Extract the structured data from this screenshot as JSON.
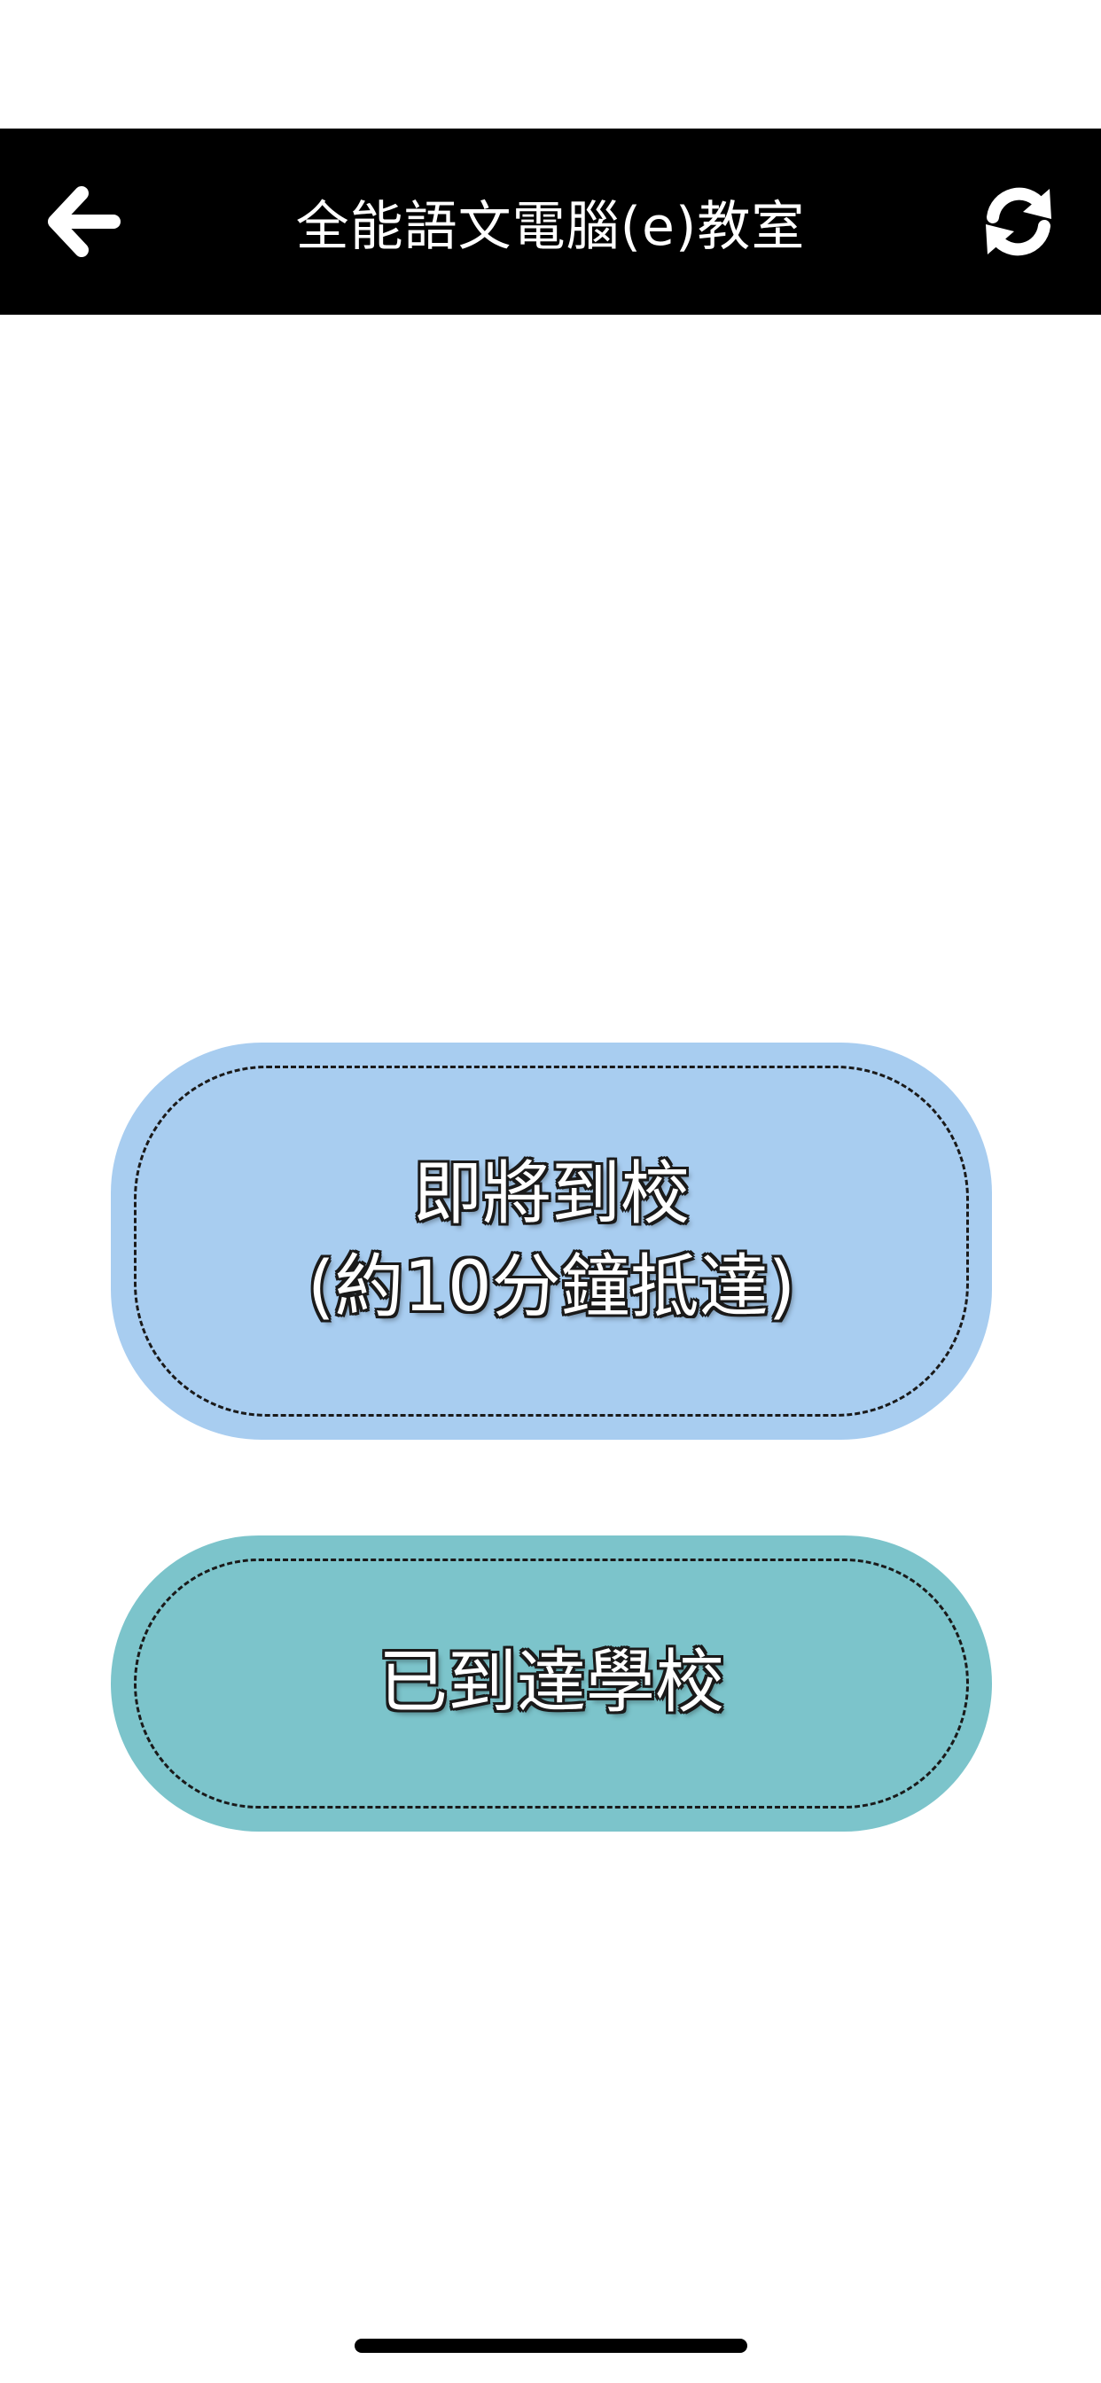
{
  "header": {
    "title": "全能語文電腦(e)教室",
    "back_icon": "arrow-left-icon",
    "refresh_icon": "refresh-icon"
  },
  "actions": {
    "arriving_soon": {
      "line1": "即將到校",
      "line2": "(約10分鐘抵達)",
      "color": "#A8CDF0"
    },
    "arrived": {
      "label": "已到達學校",
      "color": "#7CC4CB"
    }
  },
  "colors": {
    "header_bg": "#000000",
    "page_bg": "#FFFFFF"
  }
}
